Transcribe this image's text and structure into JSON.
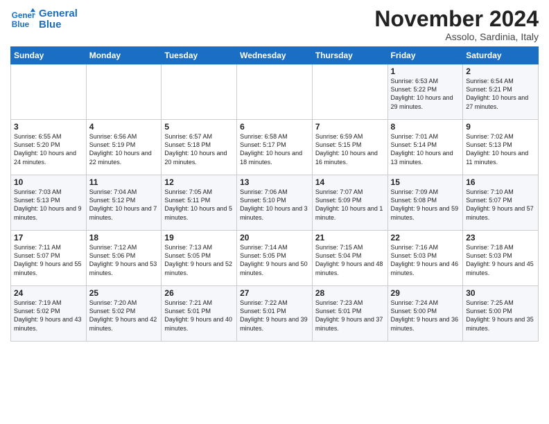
{
  "logo": {
    "text_line1": "General",
    "text_line2": "Blue"
  },
  "title": "November 2024",
  "location": "Assolo, Sardinia, Italy",
  "days_of_week": [
    "Sunday",
    "Monday",
    "Tuesday",
    "Wednesday",
    "Thursday",
    "Friday",
    "Saturday"
  ],
  "weeks": [
    [
      {
        "day": "",
        "content": ""
      },
      {
        "day": "",
        "content": ""
      },
      {
        "day": "",
        "content": ""
      },
      {
        "day": "",
        "content": ""
      },
      {
        "day": "",
        "content": ""
      },
      {
        "day": "1",
        "content": "Sunrise: 6:53 AM\nSunset: 5:22 PM\nDaylight: 10 hours and 29 minutes."
      },
      {
        "day": "2",
        "content": "Sunrise: 6:54 AM\nSunset: 5:21 PM\nDaylight: 10 hours and 27 minutes."
      }
    ],
    [
      {
        "day": "3",
        "content": "Sunrise: 6:55 AM\nSunset: 5:20 PM\nDaylight: 10 hours and 24 minutes."
      },
      {
        "day": "4",
        "content": "Sunrise: 6:56 AM\nSunset: 5:19 PM\nDaylight: 10 hours and 22 minutes."
      },
      {
        "day": "5",
        "content": "Sunrise: 6:57 AM\nSunset: 5:18 PM\nDaylight: 10 hours and 20 minutes."
      },
      {
        "day": "6",
        "content": "Sunrise: 6:58 AM\nSunset: 5:17 PM\nDaylight: 10 hours and 18 minutes."
      },
      {
        "day": "7",
        "content": "Sunrise: 6:59 AM\nSunset: 5:15 PM\nDaylight: 10 hours and 16 minutes."
      },
      {
        "day": "8",
        "content": "Sunrise: 7:01 AM\nSunset: 5:14 PM\nDaylight: 10 hours and 13 minutes."
      },
      {
        "day": "9",
        "content": "Sunrise: 7:02 AM\nSunset: 5:13 PM\nDaylight: 10 hours and 11 minutes."
      }
    ],
    [
      {
        "day": "10",
        "content": "Sunrise: 7:03 AM\nSunset: 5:13 PM\nDaylight: 10 hours and 9 minutes."
      },
      {
        "day": "11",
        "content": "Sunrise: 7:04 AM\nSunset: 5:12 PM\nDaylight: 10 hours and 7 minutes."
      },
      {
        "day": "12",
        "content": "Sunrise: 7:05 AM\nSunset: 5:11 PM\nDaylight: 10 hours and 5 minutes."
      },
      {
        "day": "13",
        "content": "Sunrise: 7:06 AM\nSunset: 5:10 PM\nDaylight: 10 hours and 3 minutes."
      },
      {
        "day": "14",
        "content": "Sunrise: 7:07 AM\nSunset: 5:09 PM\nDaylight: 10 hours and 1 minute."
      },
      {
        "day": "15",
        "content": "Sunrise: 7:09 AM\nSunset: 5:08 PM\nDaylight: 9 hours and 59 minutes."
      },
      {
        "day": "16",
        "content": "Sunrise: 7:10 AM\nSunset: 5:07 PM\nDaylight: 9 hours and 57 minutes."
      }
    ],
    [
      {
        "day": "17",
        "content": "Sunrise: 7:11 AM\nSunset: 5:07 PM\nDaylight: 9 hours and 55 minutes."
      },
      {
        "day": "18",
        "content": "Sunrise: 7:12 AM\nSunset: 5:06 PM\nDaylight: 9 hours and 53 minutes."
      },
      {
        "day": "19",
        "content": "Sunrise: 7:13 AM\nSunset: 5:05 PM\nDaylight: 9 hours and 52 minutes."
      },
      {
        "day": "20",
        "content": "Sunrise: 7:14 AM\nSunset: 5:05 PM\nDaylight: 9 hours and 50 minutes."
      },
      {
        "day": "21",
        "content": "Sunrise: 7:15 AM\nSunset: 5:04 PM\nDaylight: 9 hours and 48 minutes."
      },
      {
        "day": "22",
        "content": "Sunrise: 7:16 AM\nSunset: 5:03 PM\nDaylight: 9 hours and 46 minutes."
      },
      {
        "day": "23",
        "content": "Sunrise: 7:18 AM\nSunset: 5:03 PM\nDaylight: 9 hours and 45 minutes."
      }
    ],
    [
      {
        "day": "24",
        "content": "Sunrise: 7:19 AM\nSunset: 5:02 PM\nDaylight: 9 hours and 43 minutes."
      },
      {
        "day": "25",
        "content": "Sunrise: 7:20 AM\nSunset: 5:02 PM\nDaylight: 9 hours and 42 minutes."
      },
      {
        "day": "26",
        "content": "Sunrise: 7:21 AM\nSunset: 5:01 PM\nDaylight: 9 hours and 40 minutes."
      },
      {
        "day": "27",
        "content": "Sunrise: 7:22 AM\nSunset: 5:01 PM\nDaylight: 9 hours and 39 minutes."
      },
      {
        "day": "28",
        "content": "Sunrise: 7:23 AM\nSunset: 5:01 PM\nDaylight: 9 hours and 37 minutes."
      },
      {
        "day": "29",
        "content": "Sunrise: 7:24 AM\nSunset: 5:00 PM\nDaylight: 9 hours and 36 minutes."
      },
      {
        "day": "30",
        "content": "Sunrise: 7:25 AM\nSunset: 5:00 PM\nDaylight: 9 hours and 35 minutes."
      }
    ]
  ]
}
